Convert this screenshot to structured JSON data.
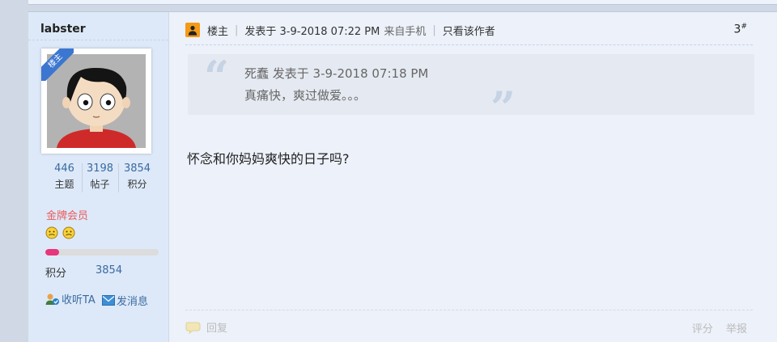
{
  "user": {
    "name": "labster",
    "badge": "楼主",
    "stats": [
      {
        "num": "446",
        "label": "主题"
      },
      {
        "num": "3198",
        "label": "帖子"
      },
      {
        "num": "3854",
        "label": "积分"
      }
    ],
    "level": "金牌会员",
    "smileys": 2,
    "progress_fraction": 0.12,
    "score_label": "积分",
    "score_value": "3854",
    "follow_label": "收听TA",
    "message_label": "发消息"
  },
  "post": {
    "lz": "楼主",
    "posted": "发表于 3-9-2018 07:22 PM",
    "source": "来自手机",
    "only_author": "只看该作者",
    "floor": "3",
    "floor_sup": "#",
    "quote": {
      "author_line": "死蠢 发表于 3-9-2018 07:18 PM",
      "text": "真痛快，爽过做爱。。。"
    },
    "content": "怀念和你妈妈爽快的日子吗?",
    "reply_label": "回复",
    "rate_label": "评分",
    "report_label": "举报"
  },
  "colors": {
    "page_bg": "#cfd8e4",
    "sidebar_bg": "#dde9f8",
    "main_bg": "#ecf1fa",
    "link_blue": "#3a6aa1",
    "level_red": "#ea5b5b",
    "lz_orange": "#f39a17",
    "progress_pink": "#e8357c"
  },
  "icons": [
    "lz-icon",
    "smiley-icon",
    "follow-icon",
    "message-icon",
    "reply-icon",
    "quote-open-icon",
    "quote-close-icon"
  ]
}
